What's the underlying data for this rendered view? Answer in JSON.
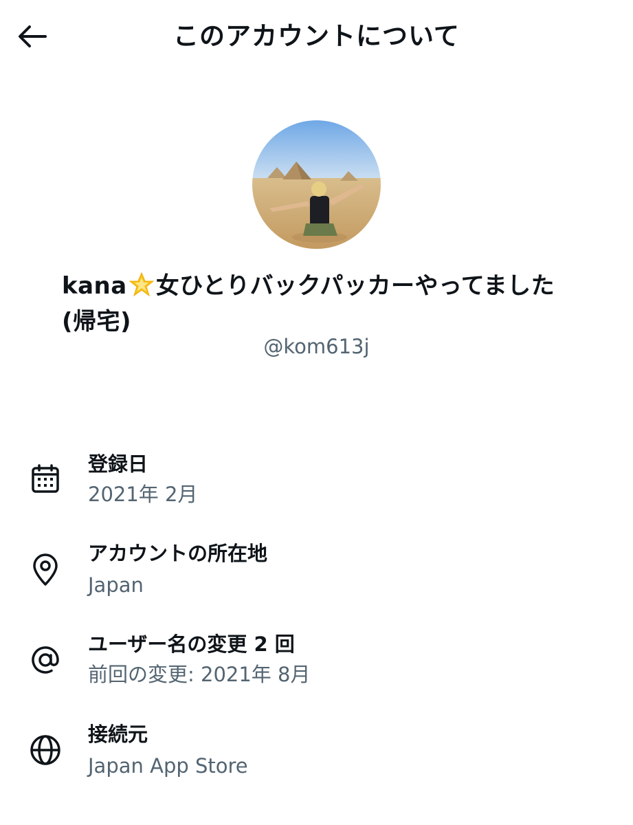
{
  "header": {
    "title": "このアカウントについて",
    "back_icon": "arrow-left-icon"
  },
  "profile": {
    "name_prefix": "kana",
    "name_emoji": "star-emoji",
    "name_suffix": "女ひとりバックパッカーやってました(帰宅)",
    "handle": "@kom613j"
  },
  "details": [
    {
      "icon": "calendar-icon",
      "label": "登録日",
      "value": "2021年 2月"
    },
    {
      "icon": "location-pin-icon",
      "label": "アカウントの所在地",
      "value": "Japan"
    },
    {
      "icon": "at-sign-icon",
      "label": "ユーザー名の変更 2 回",
      "value": "前回の変更: 2021年 8月"
    },
    {
      "icon": "globe-icon",
      "label": "接続元",
      "value": "Japan App Store"
    }
  ],
  "colors": {
    "text_primary": "#0f1419",
    "text_secondary": "#536471",
    "background": "#ffffff"
  }
}
